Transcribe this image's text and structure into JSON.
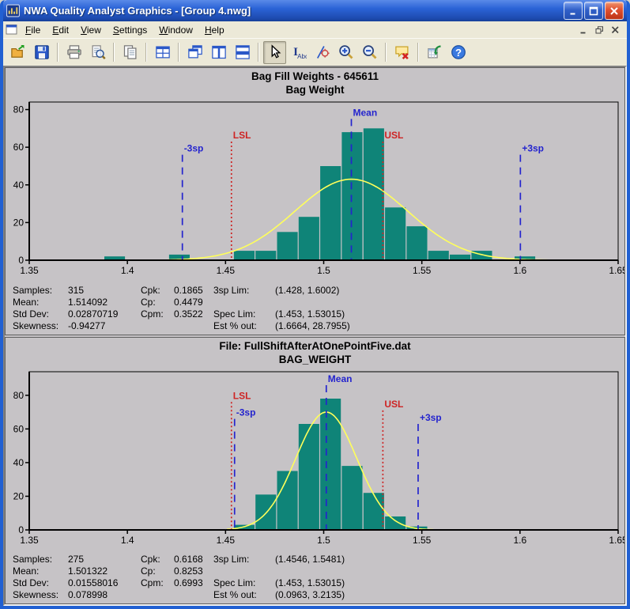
{
  "window": {
    "title": "NWA Quality Analyst Graphics - [Group 4.nwg]"
  },
  "menu": {
    "items": [
      "File",
      "Edit",
      "View",
      "Settings",
      "Window",
      "Help"
    ]
  },
  "toolbar": {
    "buttons": [
      "open",
      "save",
      "|",
      "print",
      "print-preview",
      "|",
      "copy",
      "|",
      "tile-grid",
      "|",
      "cascade",
      "tile-vertical",
      "tile-horizontal",
      "|",
      "select",
      "text-annotate",
      "point-label",
      "zoom-in",
      "zoom-out",
      "|",
      "delete-annotation",
      "|",
      "export-data",
      "help"
    ],
    "active": "select"
  },
  "colors": {
    "bar": "#0F8478",
    "curve": "#FFFF5A",
    "sigma_line": "#2424CE",
    "spec_line": "#CE2424",
    "plot_bg": "#C6C3C6"
  },
  "chart_data": [
    {
      "type": "bar",
      "title": "Bag Fill Weights - 645611",
      "subtitle": "Bag Weight",
      "xlim": [
        1.35,
        1.65
      ],
      "ylim": [
        0,
        84
      ],
      "xtick_values": [
        1.35,
        1.4,
        1.45,
        1.5,
        1.55,
        1.6,
        1.65
      ],
      "xtick_labels": [
        "1.35",
        "1.4",
        "1.45",
        "1.5",
        "1.55",
        "1.6",
        "1.65"
      ],
      "ytick_values": [
        0,
        20,
        40,
        60,
        80
      ],
      "bin_width": 0.011,
      "bars": [
        {
          "x": 1.388,
          "count": 2
        },
        {
          "x": 1.421,
          "count": 3
        },
        {
          "x": 1.454,
          "count": 5
        },
        {
          "x": 1.465,
          "count": 5
        },
        {
          "x": 1.476,
          "count": 15
        },
        {
          "x": 1.487,
          "count": 23
        },
        {
          "x": 1.498,
          "count": 50
        },
        {
          "x": 1.509,
          "count": 68
        },
        {
          "x": 1.52,
          "count": 70
        },
        {
          "x": 1.531,
          "count": 28
        },
        {
          "x": 1.542,
          "count": 18
        },
        {
          "x": 1.553,
          "count": 5
        },
        {
          "x": 1.564,
          "count": 3
        },
        {
          "x": 1.575,
          "count": 5
        },
        {
          "x": 1.597,
          "count": 2
        }
      ],
      "normal_curve": {
        "mean": 1.514092,
        "sd": 0.02870719,
        "peak": 43
      },
      "reflines": [
        {
          "label": "-3sp",
          "x": 1.428,
          "top": 56,
          "kind": "sigma"
        },
        {
          "label": "LSL",
          "x": 1.453,
          "top": 63,
          "kind": "spec"
        },
        {
          "label": "Mean",
          "x": 1.514092,
          "top": 75,
          "kind": "sigma"
        },
        {
          "label": "USL",
          "x": 1.53015,
          "top": 63,
          "kind": "spec"
        },
        {
          "label": "+3sp",
          "x": 1.6002,
          "top": 56,
          "kind": "sigma"
        }
      ],
      "stats": [
        [
          "Samples:",
          "315",
          "Cpk:",
          "0.1865",
          "3sp Lim:",
          "(1.428, 1.6002)"
        ],
        [
          "Mean:",
          "1.514092",
          "Cp:",
          "0.4479",
          "",
          ""
        ],
        [
          "Std Dev:",
          "0.02870719",
          "Cpm:",
          "0.3522",
          "Spec Lim:",
          "(1.453, 1.53015)"
        ],
        [
          "Skewness:",
          "-0.94277",
          "",
          "",
          "Est % out:",
          "(1.6664, 28.7955)"
        ]
      ]
    },
    {
      "type": "bar",
      "title": "File: FullShiftAfterAtOnePointFive.dat",
      "subtitle": "BAG_WEIGHT",
      "xlim": [
        1.35,
        1.65
      ],
      "ylim": [
        0,
        94
      ],
      "xtick_values": [
        1.35,
        1.4,
        1.45,
        1.5,
        1.55,
        1.6,
        1.65
      ],
      "xtick_labels": [
        "1.35",
        "1.4",
        "1.45",
        "1.5",
        "1.55",
        "1.6",
        "1.65"
      ],
      "ytick_values": [
        0,
        20,
        40,
        60,
        80
      ],
      "bin_width": 0.011,
      "bars": [
        {
          "x": 1.454,
          "count": 3
        },
        {
          "x": 1.465,
          "count": 21
        },
        {
          "x": 1.476,
          "count": 35
        },
        {
          "x": 1.487,
          "count": 63
        },
        {
          "x": 1.498,
          "count": 78
        },
        {
          "x": 1.509,
          "count": 38
        },
        {
          "x": 1.52,
          "count": 22
        },
        {
          "x": 1.531,
          "count": 8
        },
        {
          "x": 1.542,
          "count": 2
        }
      ],
      "normal_curve": {
        "mean": 1.501322,
        "sd": 0.01558016,
        "peak": 70
      },
      "reflines": [
        {
          "label": "LSL",
          "x": 1.453,
          "top": 76,
          "kind": "spec"
        },
        {
          "label": "-3sp",
          "x": 1.4546,
          "top": 66,
          "kind": "sigma"
        },
        {
          "label": "Mean",
          "x": 1.501322,
          "top": 86,
          "kind": "sigma"
        },
        {
          "label": "USL",
          "x": 1.53015,
          "top": 71,
          "kind": "spec"
        },
        {
          "label": "+3sp",
          "x": 1.5481,
          "top": 63,
          "kind": "sigma"
        }
      ],
      "stats": [
        [
          "Samples:",
          "275",
          "Cpk:",
          "0.6168",
          "3sp Lim:",
          "(1.4546, 1.5481)"
        ],
        [
          "Mean:",
          "1.501322",
          "Cp:",
          "0.8253",
          "",
          ""
        ],
        [
          "Std Dev:",
          "0.01558016",
          "Cpm:",
          "0.6993",
          "Spec Lim:",
          "(1.453, 1.53015)"
        ],
        [
          "Skewness:",
          "0.078998",
          "",
          "",
          "Est % out:",
          "(0.0963, 3.2135)"
        ]
      ]
    }
  ]
}
